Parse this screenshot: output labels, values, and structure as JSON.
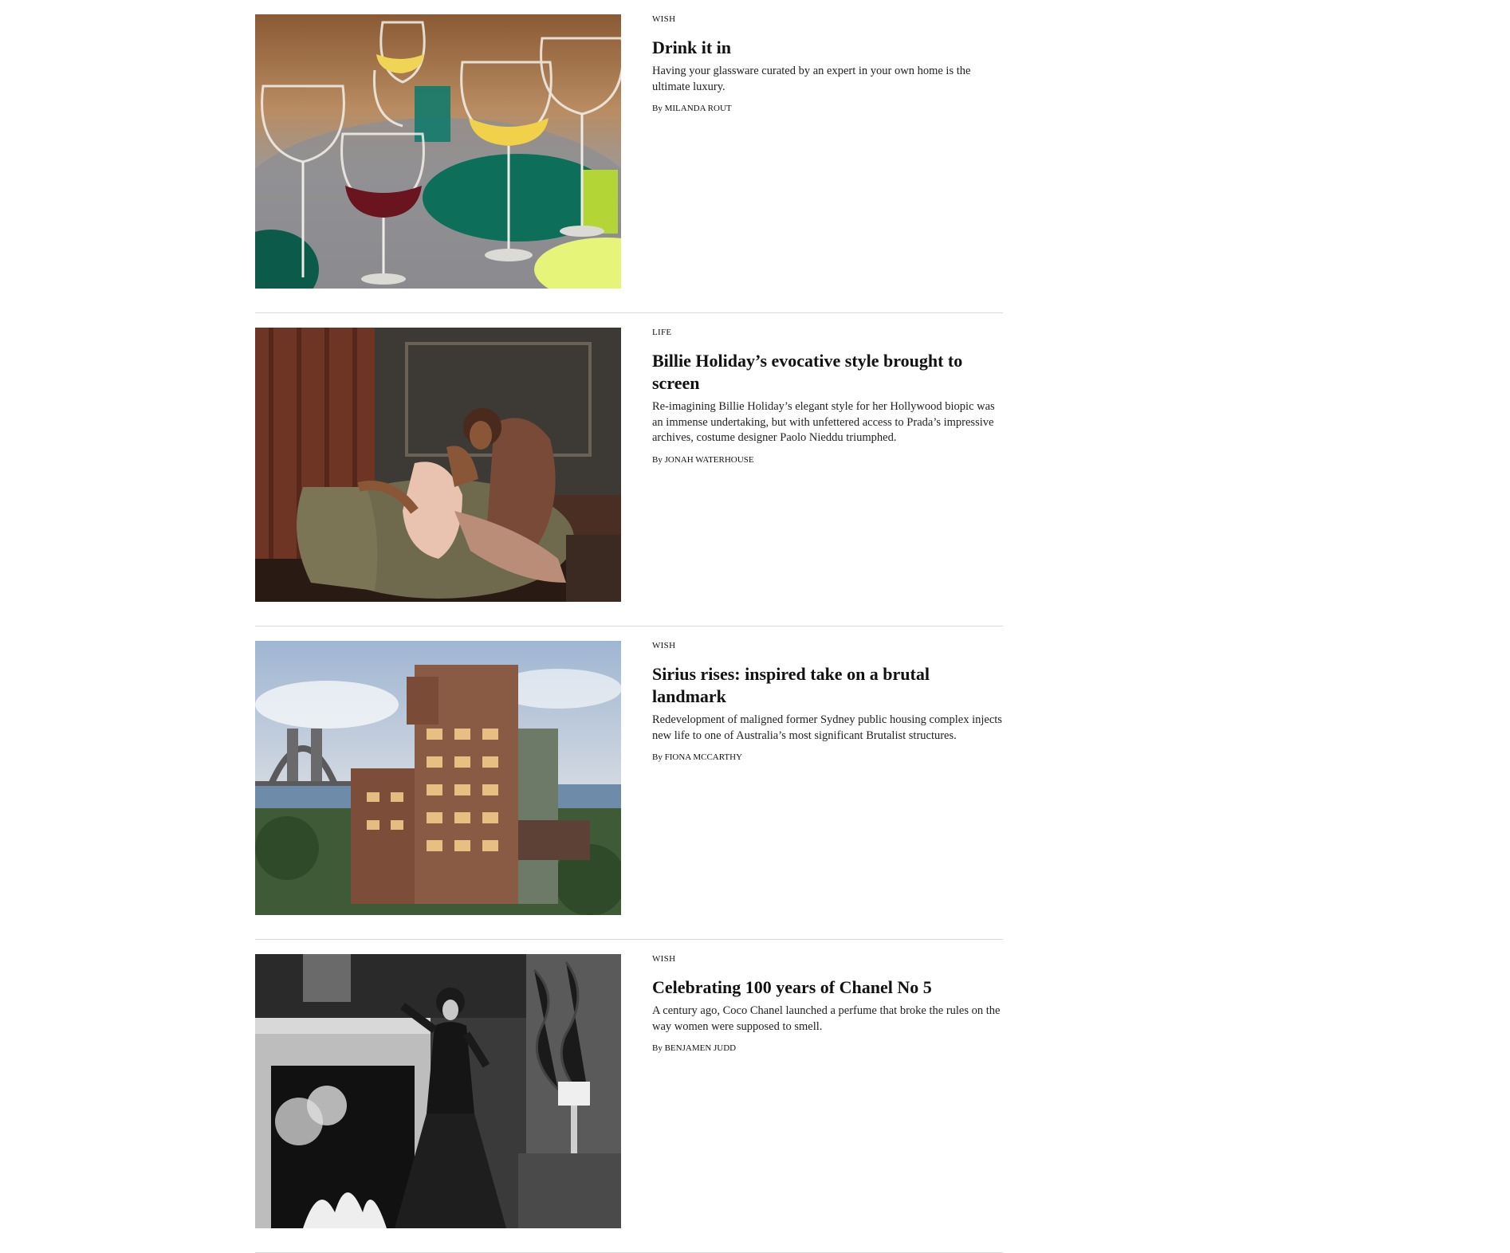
{
  "articles": [
    {
      "section": "WISH",
      "headline": "Drink it in",
      "summary": "Having your glassware curated by an expert in your own home is the ultimate luxury.",
      "by_prefix": "By",
      "author": "MILANDA ROUT",
      "image_subject": "wine-glasses-table"
    },
    {
      "section": "LIFE",
      "headline": "Billie Holiday’s evocative style brought to screen",
      "summary": "Re-imagining Billie Holiday’s elegant style for her Hollywood biopic was an immense undertaking, but with unfettered access to Prada’s impressive archives, costume designer Paolo Nieddu triumphed.",
      "by_prefix": "By",
      "author": "JONAH WATERHOUSE",
      "image_subject": "woman-in-armchair"
    },
    {
      "section": "WISH",
      "headline": "Sirius rises: inspired take on a brutal landmark",
      "summary": "Redevelopment of maligned former Sydney public housing complex injects new life to one of Australia’s most significant Brutalist structures.",
      "by_prefix": "By",
      "author": "FIONA MCCARTHY",
      "image_subject": "sydney-apartment-building"
    },
    {
      "section": "WISH",
      "headline": "Celebrating 100 years of Chanel No 5",
      "summary": "A century ago, Coco Chanel launched a perfume that broke the rules on the way women were supposed to smell.",
      "by_prefix": "By",
      "author": "BENJAMEN JUDD",
      "image_subject": "coco-chanel-fireplace"
    }
  ]
}
